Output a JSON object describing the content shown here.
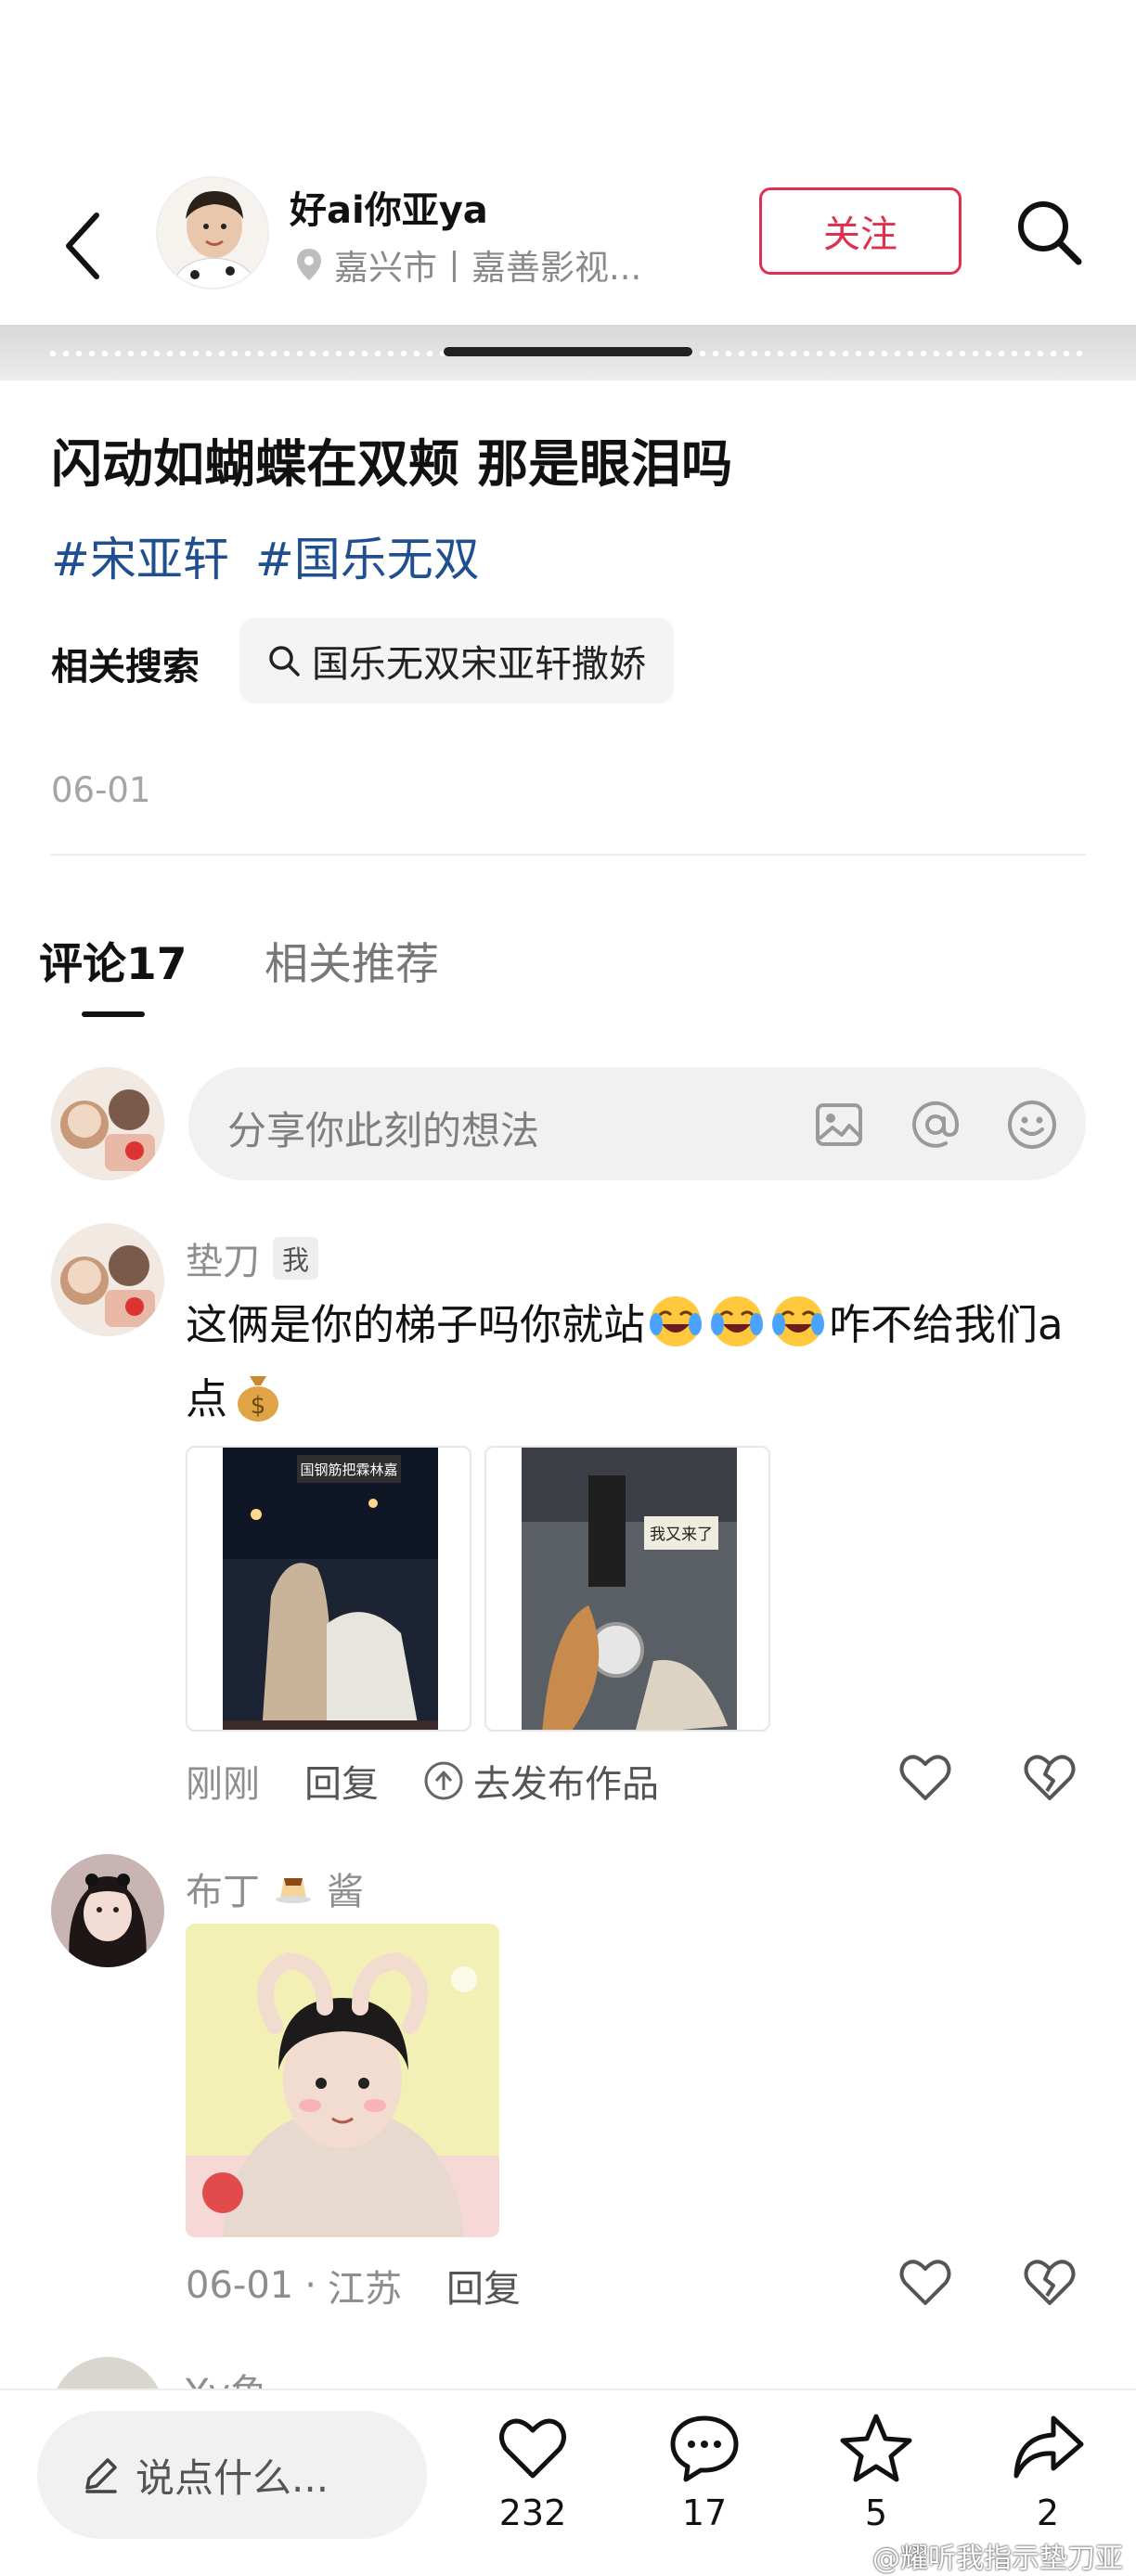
{
  "author": {
    "name": "好ai你亚ya",
    "location": "嘉兴市丨嘉善影视...",
    "follow_label": "关注"
  },
  "post": {
    "title": "闪动如蝴蝶在双颊 那是眼泪吗",
    "hashtags": [
      "#宋亚轩",
      "#国乐无双"
    ],
    "related_label": "相关搜索",
    "related_query": "国乐无双宋亚轩撒娇",
    "date": "06-01"
  },
  "tabs": {
    "comments": "评论17",
    "related": "相关推荐"
  },
  "comment_input": {
    "placeholder": "分享你此刻的想法"
  },
  "comments": [
    {
      "user": "垫刀",
      "badge": "我",
      "text_parts": [
        "这俩是你的梯子吗你就站",
        "咋不给我们a点"
      ],
      "images": [
        {
          "caption": "国钢筋把霖林嘉"
        },
        {
          "caption": "我又来了"
        }
      ],
      "time": "刚刚",
      "reply": "回复",
      "publish": "去发布作品"
    },
    {
      "user_prefix": "布丁",
      "user_suffix": "酱",
      "time": "06-01",
      "region": "江苏",
      "dot": "·",
      "reply": "回复"
    },
    {
      "user": "Yy鱼"
    }
  ],
  "bottom_bar": {
    "say_placeholder": "说点什么...",
    "likes": "232",
    "comments": "17",
    "favorites": "5",
    "shares": "2"
  },
  "watermark": "@耀听我指示垫刀亚",
  "colors": {
    "accent": "#e0304f",
    "hashtag": "#1f4f8f"
  }
}
